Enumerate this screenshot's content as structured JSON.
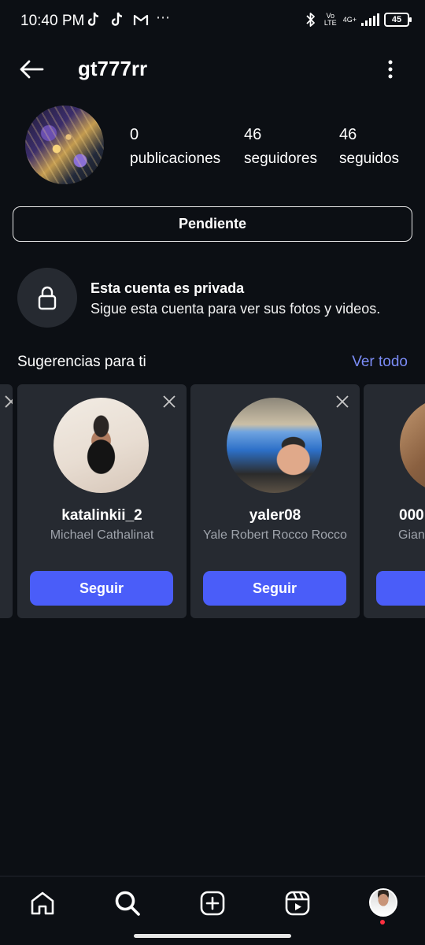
{
  "status_bar": {
    "time": "10:40 PM",
    "left_icons": [
      "tiktok-icon",
      "tiktok-icon",
      "gmail-icon"
    ],
    "more_notifications": "⋯",
    "volte": "Vo LTE",
    "network": "4G+",
    "battery": "45"
  },
  "header": {
    "username": "gt777rr",
    "back_icon": "arrow-left-icon",
    "more_icon": "more-vertical-icon"
  },
  "profile": {
    "stats": [
      {
        "value": "0",
        "label": "publicaciones"
      },
      {
        "value": "46",
        "label": "seguidores"
      },
      {
        "value": "46",
        "label": "seguidos"
      }
    ],
    "action_button": "Pendiente"
  },
  "private": {
    "title": "Esta cuenta es privada",
    "subtitle": "Sigue esta cuenta para ver sus fotos y videos."
  },
  "suggestions": {
    "title": "Sugerencias para ti",
    "see_all": "Ver todo",
    "cards": [
      {
        "username": "katalinkii_2",
        "full_name": "Michael Cathalinat",
        "button": "Seguir"
      },
      {
        "username": "yaler08",
        "full_name": "Yale Robert Rocco Rocco",
        "button": "Seguir"
      },
      {
        "username": "000",
        "full_name": "Gian",
        "button": ""
      }
    ]
  },
  "bottom_nav": {
    "items": [
      "home-icon",
      "search-icon",
      "create-icon",
      "reels-icon",
      "profile-avatar"
    ]
  },
  "colors": {
    "background": "#0c0f14",
    "card": "#262a31",
    "accent_link": "#7b8cf6",
    "follow_button": "#4a5df9",
    "notification_dot": "#ff3040"
  }
}
